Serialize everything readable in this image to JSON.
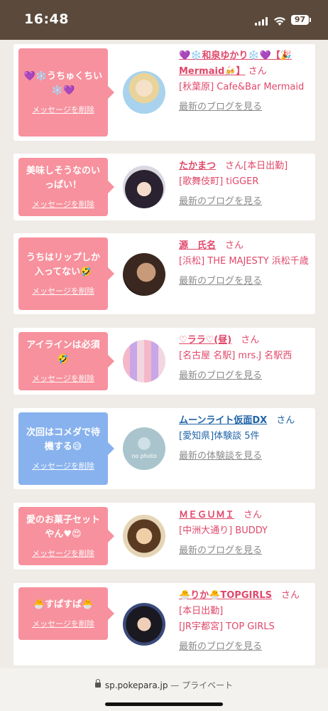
{
  "status": {
    "time": "16:48",
    "battery": "97"
  },
  "san_label": "さん",
  "cards": [
    {
      "message": "💜❄️うちゅくちい❄️💜",
      "delete_label": "メッセージを削除",
      "name": "💜❄️和泉ゆかり❄️💜【🎉Mermaid🍻】",
      "extra": "",
      "shop": "[秋葉原] Cafe&Bar Mermaid",
      "blog": "最新のブログを見る",
      "style": "pink"
    },
    {
      "message": "美味しそうなのいっぱい！",
      "delete_label": "メッセージを削除",
      "name": "たかまつ",
      "extra": "[本日出勤]",
      "shop": "[歌舞伎町] tiGGER",
      "blog": "最新のブログを見る",
      "style": "pink"
    },
    {
      "message": "うちはリップしか入ってない🤣",
      "delete_label": "メッセージを削除",
      "name": "源　氏名",
      "extra": "",
      "shop": "[浜松] THE MAJESTY 浜松千歳",
      "blog": "最新のブログを見る",
      "style": "pink"
    },
    {
      "message": "アイラインは必須🤣",
      "delete_label": "メッセージを削除",
      "name": "♡ララ♡(昼)",
      "extra": "",
      "shop": "[名古屋 名駅] mrs.J 名駅西",
      "blog": "最新のブログを見る",
      "style": "pink"
    },
    {
      "message": "次回はコメダで待機する😅",
      "delete_label": "メッセージを削除",
      "name": "ムーンライト仮面DX",
      "extra": "",
      "shop": "[愛知県]体験談 5件",
      "blog": "最新の体験談を見る",
      "style": "blue",
      "avatar_text": "no photo"
    },
    {
      "message": "愛のお菓子セットやん♥😍",
      "delete_label": "メッセージを削除",
      "name": "ＭＥＧＵＭＩ",
      "extra": "",
      "shop": "[中洲大通り] BUDDY",
      "blog": "最新のブログを見る",
      "style": "pink"
    },
    {
      "message": "🐣すぱすぱ🐣",
      "delete_label": "メッセージを削除",
      "name": "🐣りか🐣TOPGIRLS",
      "extra": "[本日出勤]",
      "shop": "[JR宇都宮] TOP GIRLS",
      "blog": "最新のブログを見る",
      "style": "pink"
    }
  ],
  "urlbar": {
    "domain": "sp.pokepara.jp",
    "suffix": "— プライベート"
  }
}
